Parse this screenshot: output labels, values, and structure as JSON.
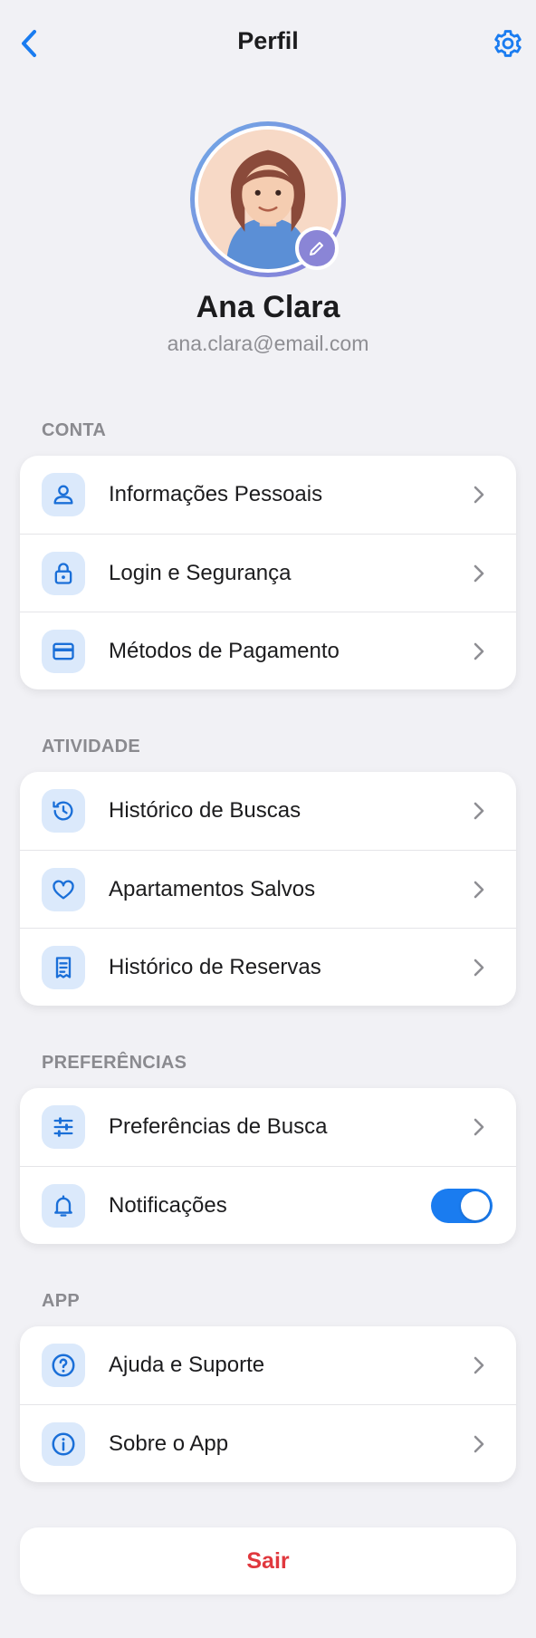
{
  "header": {
    "title": "Perfil",
    "back_icon": "chevron-left-icon",
    "settings_icon": "gear-icon"
  },
  "profile": {
    "name": "Ana Clara",
    "email": "ana.clara@email.com",
    "edit_icon": "pencil-icon"
  },
  "sections": {
    "conta": {
      "label": "CONTA",
      "items": [
        {
          "label": "Informações Pessoais",
          "icon": "user-icon"
        },
        {
          "label": "Login e Segurança",
          "icon": "lock-icon"
        },
        {
          "label": "Métodos de Pagamento",
          "icon": "credit-card-icon"
        }
      ]
    },
    "atividade": {
      "label": "ATIVIDADE",
      "items": [
        {
          "label": "Histórico de Buscas",
          "icon": "history-icon"
        },
        {
          "label": "Apartamentos Salvos",
          "icon": "heart-icon"
        },
        {
          "label": "Histórico de Reservas",
          "icon": "receipt-icon"
        }
      ]
    },
    "preferencias": {
      "label": "PREFERÊNCIAS",
      "items": [
        {
          "label": "Preferências de Busca",
          "icon": "sliders-icon"
        },
        {
          "label": "Notificações",
          "icon": "bell-icon",
          "toggle_on": true
        }
      ]
    },
    "app": {
      "label": "APP",
      "items": [
        {
          "label": "Ajuda e Suporte",
          "icon": "help-circle-icon"
        },
        {
          "label": "Sobre o App",
          "icon": "info-icon"
        }
      ]
    }
  },
  "logout": {
    "label": "Sair"
  },
  "colors": {
    "accent": "#1a7cf0",
    "icon_bg": "#dbe9fb",
    "danger": "#e0383e",
    "background": "#f1f1f5"
  }
}
